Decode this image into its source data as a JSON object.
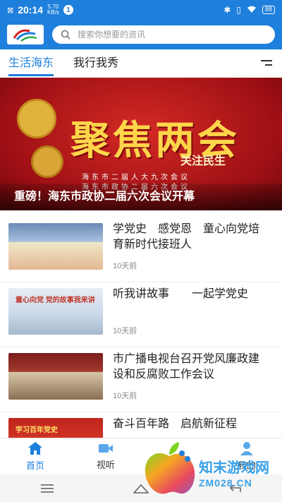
{
  "status_bar": {
    "time": "20:14",
    "net_speed_value": "5.70",
    "net_speed_unit": "KB/s",
    "notification_count": "1",
    "battery": "88"
  },
  "header": {
    "search_placeholder": "搜索你想要的资讯"
  },
  "tabs": [
    {
      "label": "生活海东",
      "active": true
    },
    {
      "label": "我行我秀",
      "active": false
    }
  ],
  "banner": {
    "big_text": "聚焦两会",
    "slogan": "关注民生",
    "line1": "海东市二届人大九次会议",
    "line2": "海东市政协二届六次会议",
    "caption": "重磅！海东市政协二届六次会议开幕"
  },
  "news": [
    {
      "title": "学党史　感党恩　童心向党培育新时代接班人",
      "time": "10天前"
    },
    {
      "title": "听我讲故事　　一起学党史",
      "time": "10天前",
      "thumb_text": "童心向党 党的故事我来讲"
    },
    {
      "title": "市广播电视台召开党风廉政建设和反腐败工作会议",
      "time": "10天前"
    },
    {
      "title": "奋斗百年路　启航新征程",
      "time": "",
      "thumb_text": "学习百年党史"
    }
  ],
  "bottom_nav": [
    {
      "label": "首页",
      "icon": "home-icon",
      "active": true
    },
    {
      "label": "视听",
      "icon": "video-icon",
      "active": false
    },
    {
      "label": "",
      "icon": "center-icon",
      "active": false
    },
    {
      "label": "我的",
      "icon": "user-icon",
      "active": false
    }
  ],
  "watermark": {
    "name": "知末游戏网",
    "url": "ZM028.CN"
  },
  "colors": {
    "primary": "#1e7fdc",
    "banner_red": "#b5121b",
    "gold": "#ffd54a"
  }
}
